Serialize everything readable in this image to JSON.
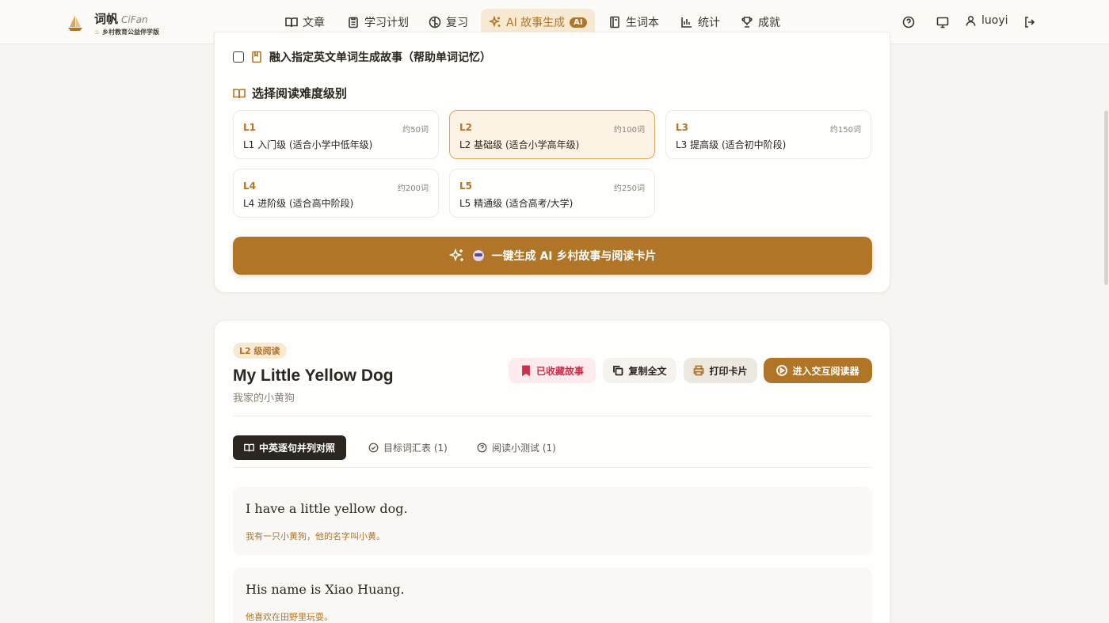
{
  "brand": {
    "name": "词帆",
    "name_en": "CiFan",
    "tagline": "乡村教育公益伴学版"
  },
  "nav": [
    {
      "label": "文章",
      "icon": "book-open-icon"
    },
    {
      "label": "学习计划",
      "icon": "clipboard-icon"
    },
    {
      "label": "复习",
      "icon": "brain-icon"
    },
    {
      "label": "AI 故事生成",
      "icon": "sparkles-icon",
      "badge": "AI",
      "active": true
    },
    {
      "label": "生词本",
      "icon": "notebook-icon"
    },
    {
      "label": "统计",
      "icon": "bar-chart-icon"
    },
    {
      "label": "成就",
      "icon": "trophy-icon"
    }
  ],
  "user": {
    "name": "luoyi"
  },
  "options": {
    "embed_words_label": "融入指定英文单词生成故事（帮助单词记忆）",
    "embed_words_checked": false
  },
  "levels_section": {
    "title": "选择阅读难度级别",
    "levels": [
      {
        "code": "L1",
        "words": "约50词",
        "desc": "L1 入门级 (适合小学中低年级)",
        "selected": false
      },
      {
        "code": "L2",
        "words": "约100词",
        "desc": "L2 基础级 (适合小学高年级)",
        "selected": true
      },
      {
        "code": "L3",
        "words": "约150词",
        "desc": "L3 提高级 (适合初中阶段)",
        "selected": false
      },
      {
        "code": "L4",
        "words": "约200词",
        "desc": "L4 进阶级 (适合高中阶段)",
        "selected": false
      },
      {
        "code": "L5",
        "words": "约250词",
        "desc": "L5 精通级 (适合高考/大学)",
        "selected": false
      }
    ]
  },
  "generate_label": "一键生成 AI 乡村故事与阅读卡片",
  "story": {
    "level_tag": "L2 级阅读",
    "title": "My Little Yellow Dog",
    "subtitle": "我家的小黄狗",
    "actions": {
      "favorited": "已收藏故事",
      "copy": "复制全文",
      "print": "打印卡片",
      "reader": "进入交互阅读器"
    },
    "tabs": [
      {
        "label": "中英逐句并列对照",
        "active": true
      },
      {
        "label": "目标词汇表 (1)",
        "active": false
      },
      {
        "label": "阅读小测试 (1)",
        "active": false
      }
    ],
    "sentences": [
      {
        "en": "I have a little yellow dog.",
        "zh": "我有一只小黄狗，他的名字叫小黄。"
      },
      {
        "en": "His name is Xiao Huang.",
        "zh": "他喜欢在田野里玩耍。"
      }
    ]
  },
  "colors": {
    "accent": "#b07527",
    "accent_soft": "#f8ead2",
    "favorite": "#c9304a",
    "background": "#f7f5f1",
    "dark_tab": "#2b2620"
  }
}
